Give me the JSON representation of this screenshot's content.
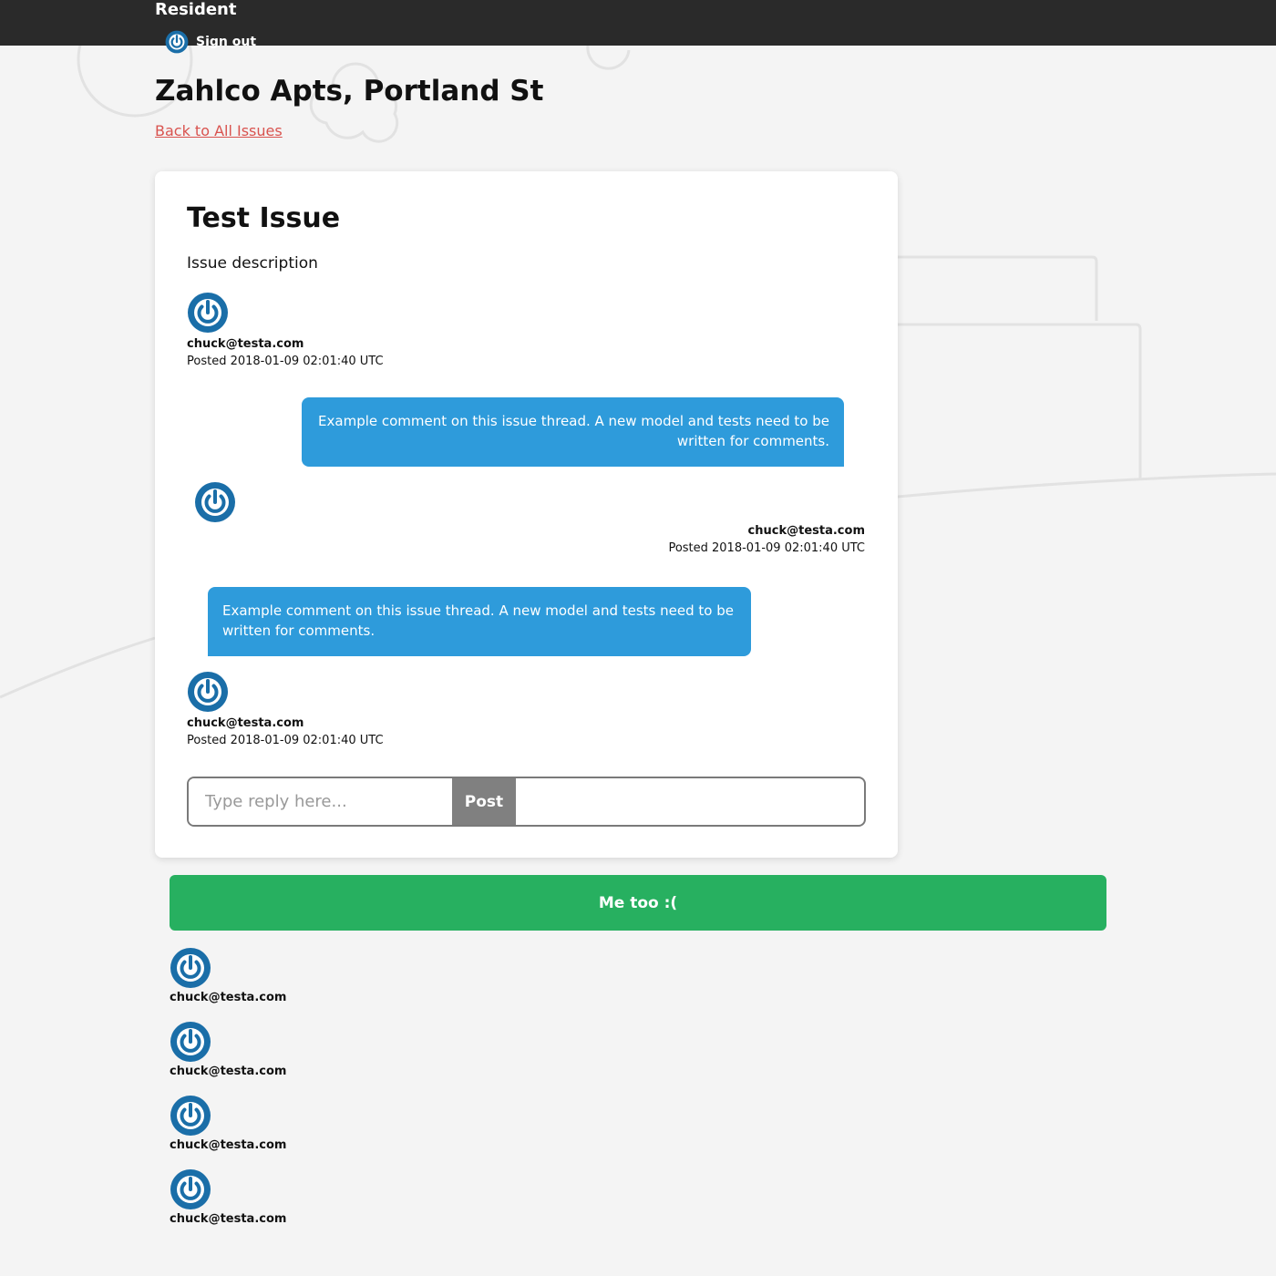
{
  "header": {
    "brand": "Resident",
    "signout_label": "Sign out",
    "avatar_icon": "power-avatar-icon"
  },
  "page": {
    "title": "Zahlco Apts, Portland St",
    "back_link": "Back to All Issues"
  },
  "issue": {
    "title": "Test Issue",
    "description": "Issue description",
    "author": {
      "email": "chuck@testa.com",
      "posted": "Posted 2018-01-09 02:01:40 UTC"
    }
  },
  "comments": [
    {
      "text": "Example comment on this issue thread. A new model and tests need to be written for comments.",
      "align": "right",
      "email": "chuck@testa.com",
      "posted": "Posted 2018-01-09 02:01:40 UTC"
    },
    {
      "text": "Example comment on this issue thread. A new model and tests need to be written for comments.",
      "align": "left",
      "email": "chuck@testa.com",
      "posted": "Posted 2018-01-09 02:01:40 UTC"
    }
  ],
  "reply": {
    "placeholder": "Type reply here...",
    "post_label": "Post"
  },
  "metoo": {
    "label": "Me too :("
  },
  "followers": [
    {
      "email": "chuck@testa.com"
    },
    {
      "email": "chuck@testa.com"
    },
    {
      "email": "chuck@testa.com"
    },
    {
      "email": "chuck@testa.com"
    }
  ],
  "colors": {
    "comment_bubble": "#2e9bdb",
    "metoo": "#27b060",
    "back_link": "#d9534f",
    "topbar": "#2a2a2a"
  }
}
